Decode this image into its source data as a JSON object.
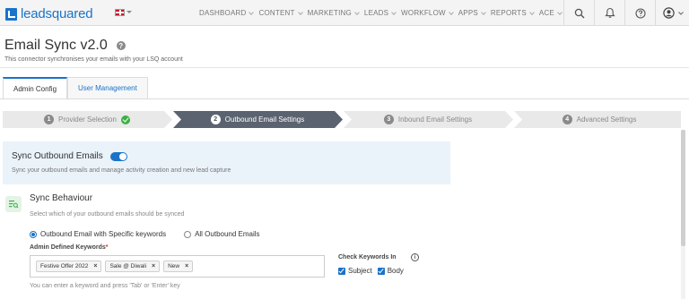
{
  "nav": {
    "logo_text": "leadsquared",
    "menu": [
      "DASHBOARD",
      "CONTENT",
      "MARKETING",
      "LEADS",
      "WORKFLOW",
      "APPS",
      "REPORTS",
      "ACE"
    ]
  },
  "header": {
    "title": "Email Sync v2.0",
    "help_glyph": "?",
    "subtitle": "This connector synchronises your emails with your LSQ account"
  },
  "tabs": [
    "Admin Config",
    "User Management"
  ],
  "stepper": {
    "steps": [
      {
        "num": "1",
        "label": "Provider Selection",
        "done": true
      },
      {
        "num": "2",
        "label": "Outbound Email Settings",
        "active": true
      },
      {
        "num": "3",
        "label": "Inbound Email Settings"
      },
      {
        "num": "4",
        "label": "Advanced Settings"
      }
    ]
  },
  "sync_outbound": {
    "title": "Sync Outbound Emails",
    "enabled": true,
    "description": "Sync your outbound emails and manage activity creation and new lead capture"
  },
  "behaviour": {
    "title": "Sync Behaviour",
    "description": "Select which of your outbound emails should be synced",
    "options": [
      "Outbound Email with Specific keywords",
      "All Outbound Emails"
    ],
    "selected": "Outbound Email with Specific keywords",
    "keywords_label": "Admin Defined Keywords",
    "required_mark": "*",
    "keywords": [
      "Festive Offer 2022",
      "Sale @ Diwali",
      "New"
    ],
    "remove_glyph": "×",
    "keywords_hint": "You can enter a keyword and press 'Tab' or 'Enter' key",
    "check_label": "Check Keywords In",
    "info_glyph": "i",
    "check_options": [
      "Subject",
      "Body"
    ]
  },
  "colors": {
    "accent": "#1a73c9",
    "success": "#3cb043",
    "step_active": "#5b6370",
    "step_inactive": "#e9e9e9"
  }
}
